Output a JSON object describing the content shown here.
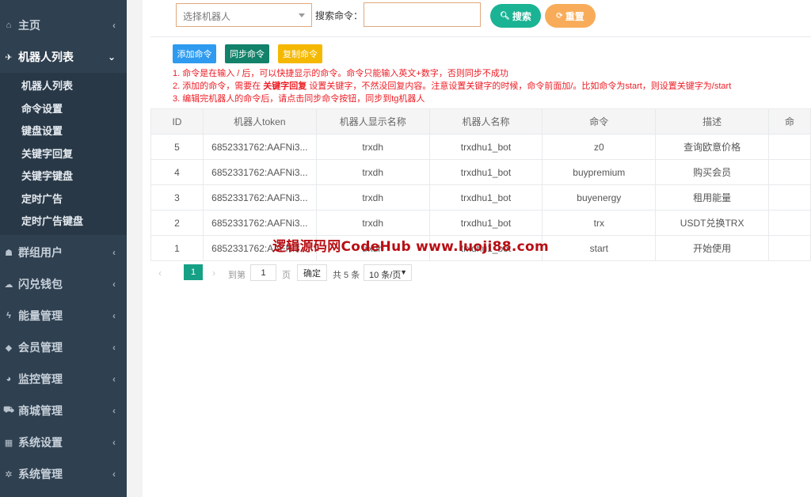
{
  "sidebar": {
    "items": [
      {
        "label": "主页",
        "icon": "home-icon",
        "glyph": "⌂"
      },
      {
        "label": "机器人列表",
        "icon": "plane-icon",
        "glyph": "✈"
      },
      {
        "label": "群组用户",
        "icon": "users-icon",
        "glyph": "☗"
      },
      {
        "label": "闪兑钱包",
        "icon": "cloud-icon",
        "glyph": "☁"
      },
      {
        "label": "能量管理",
        "icon": "bolt-icon",
        "glyph": "ϟ"
      },
      {
        "label": "会员管理",
        "icon": "diamond-icon",
        "glyph": "◆"
      },
      {
        "label": "监控管理",
        "icon": "pie-icon",
        "glyph": "◕"
      },
      {
        "label": "商城管理",
        "icon": "cart-icon",
        "glyph": "⛟"
      },
      {
        "label": "系统设置",
        "icon": "windows-icon",
        "glyph": "▦"
      },
      {
        "label": "系统管理",
        "icon": "gear-icon",
        "glyph": "✲"
      }
    ],
    "submenu": [
      "机器人列表",
      "命令设置",
      "键盘设置",
      "关键字回复",
      "关键字键盘",
      "定时广告",
      "定时广告键盘"
    ],
    "chevron_closed": "‹",
    "chevron_open": "⌄"
  },
  "filter": {
    "select_placeholder": "选择机器人",
    "search_label": "搜索命令：",
    "search_value": "",
    "search_button": "搜索",
    "reset_button": "重置"
  },
  "actions": {
    "add": "添加命令",
    "sync": "同步命令",
    "copy": "复制命令"
  },
  "notes": {
    "n1": "1. 命令是在输入 / 后，可以快捷显示的命令。命令只能输入英文+数字，否则同步不成功",
    "n2a": "2. 添加的命令，需要在",
    "n2b": "关键字回复",
    "n2c": "设置关键字，不然没回复内容。注意设置关键字的时候，命令前面加/。比如命令为start，则设置关键字为/start",
    "n3": "3. 编辑完机器人的命令后，请点击同步命令按钮，同步到tg机器人"
  },
  "table": {
    "headers": [
      "ID",
      "机器人token",
      "机器人显示名称",
      "机器人名称",
      "命令",
      "描述",
      "命"
    ],
    "rows": [
      [
        "5",
        "6852331762:AAFNi3...",
        "trxdh",
        "trxdhu1_bot",
        "z0",
        "查询欧意价格"
      ],
      [
        "4",
        "6852331762:AAFNi3...",
        "trxdh",
        "trxdhu1_bot",
        "buypremium",
        "购买会员"
      ],
      [
        "3",
        "6852331762:AAFNi3...",
        "trxdh",
        "trxdhu1_bot",
        "buyenergy",
        "租用能量"
      ],
      [
        "2",
        "6852331762:AAFNi3...",
        "trxdh",
        "trxdhu1_bot",
        "trx",
        "USDT兑换TRX"
      ],
      [
        "1",
        "6852331762:AAFNi3...",
        "trxdh",
        "trxdhu1_bot",
        "start",
        "开始使用"
      ]
    ]
  },
  "pagination": {
    "prev": "‹",
    "current": "1",
    "next": "›",
    "goto_label": "到第",
    "goto_value": "1",
    "page_label": "页",
    "confirm": "确定",
    "total": "共 5 条",
    "page_size": "10 条/页"
  },
  "watermark": "逻辑源码网CodeHub www.luoji88.com"
}
